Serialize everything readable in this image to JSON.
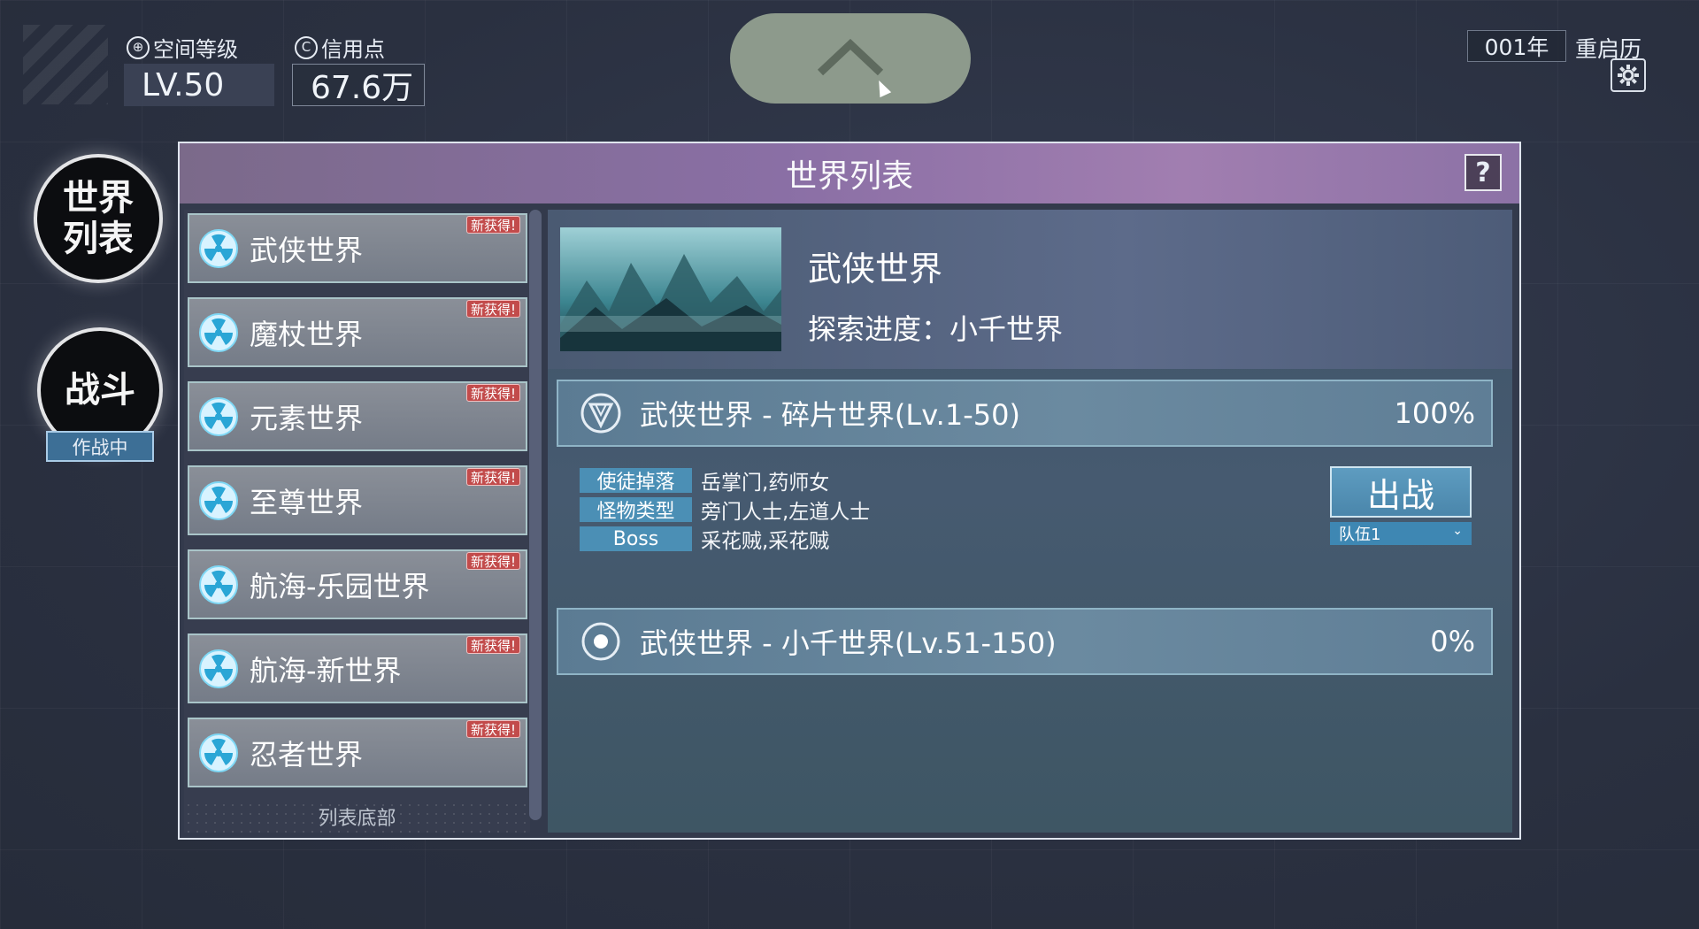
{
  "hud": {
    "space_level_label": "空间等级",
    "space_level_value": "LV.50",
    "credit_label": "信用点",
    "credit_value": "67.6万",
    "year": "001年",
    "calendar_label": "重启历"
  },
  "sidebar": {
    "world_list_label": "世界\n列表",
    "battle_label": "战斗",
    "battle_status": "作战中"
  },
  "panel": {
    "title": "世界列表",
    "help": "?",
    "list_footer": "列表底部",
    "worlds": [
      {
        "name": "武侠世界",
        "tag": "新获得!"
      },
      {
        "name": "魔杖世界",
        "tag": "新获得!"
      },
      {
        "name": "元素世界",
        "tag": "新获得!"
      },
      {
        "name": "至尊世界",
        "tag": "新获得!"
      },
      {
        "name": "航海-乐园世界",
        "tag": "新获得!"
      },
      {
        "name": "航海-新世界",
        "tag": "新获得!"
      },
      {
        "name": "忍者世界",
        "tag": "新获得!"
      }
    ]
  },
  "detail": {
    "name": "武侠世界",
    "progress": "探索进度：小千世界",
    "stages": [
      {
        "title": "武侠世界 - 碎片世界(Lv.1-50)",
        "percent": "100%"
      },
      {
        "title": "武侠世界 - 小千世界(Lv.51-150)",
        "percent": "0%"
      }
    ],
    "info": [
      {
        "tag": "使徒掉落",
        "value": "岳掌门,药师女"
      },
      {
        "tag": "怪物类型",
        "value": "旁门人士,左道人士"
      },
      {
        "tag": "Boss",
        "value": "采花贼,采花贼"
      }
    ],
    "go_button": "出战",
    "team_select": "队伍1"
  },
  "colors": {
    "accent_blue": "#4b8fb5",
    "header_purple": "#8a6fa5",
    "new_tag_red": "#c24b4b"
  }
}
